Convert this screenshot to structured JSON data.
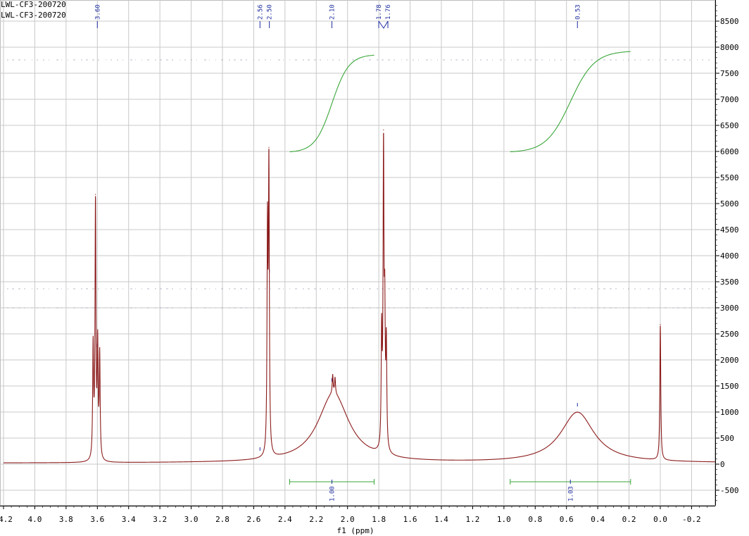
{
  "titles": [
    "LWL-CF3-200720",
    "LWL-CF3-200720"
  ],
  "chart_data": {
    "type": "line",
    "xlabel": "f1 (ppm)",
    "ylabel": "",
    "xlim": [
      4.2,
      -0.35
    ],
    "ylim": [
      -700,
      8850
    ],
    "x_reversed": true,
    "grid": true,
    "x_ticks": [
      4.2,
      4.0,
      3.8,
      3.6,
      3.4,
      3.2,
      3.0,
      2.8,
      2.6,
      2.4,
      2.2,
      2.0,
      1.8,
      1.6,
      1.4,
      1.2,
      1.0,
      0.8,
      0.6,
      0.4,
      0.2,
      0.0,
      -0.2
    ],
    "x_tick_labels": [
      "4.2",
      "4.0",
      "3.8",
      "3.6",
      "3.4",
      "3.2",
      "3.0",
      "2.8",
      "2.6",
      "2.4",
      "2.2",
      "2.0",
      "1.8",
      "1.6",
      "1.4",
      "1.2",
      "1.0",
      "0.8",
      "0.6",
      "0.4",
      "0.2",
      "0.0",
      "-0.2"
    ],
    "y_ticks": [
      -500,
      0,
      500,
      1000,
      1500,
      2000,
      2500,
      3000,
      3500,
      4000,
      4500,
      5000,
      5500,
      6000,
      6500,
      7000,
      7500,
      8000,
      8500
    ],
    "y_tick_labels": [
      "-500",
      "0",
      "500",
      "1000",
      "1500",
      "2000",
      "2500",
      "3000",
      "3500",
      "4000",
      "4500",
      "5000",
      "5500",
      "6000",
      "6500",
      "7000",
      "7500",
      "8000",
      "8500"
    ],
    "peak_labels": [
      {
        "ppm": 3.6,
        "label": "3.60"
      },
      {
        "ppm": 2.56,
        "label": "2.56"
      },
      {
        "ppm": 2.5,
        "label": "2.50"
      },
      {
        "ppm": 2.1,
        "label": "2.10"
      },
      {
        "ppm": 1.78,
        "label": "1.78"
      },
      {
        "ppm": 1.76,
        "label": "1.76"
      },
      {
        "ppm": 0.53,
        "label": "0.53"
      }
    ],
    "integrals": [
      {
        "from": 2.37,
        "to": 1.83,
        "value": "1.00",
        "curve_start": 5980,
        "curve_end": 7860
      },
      {
        "from": 0.96,
        "to": 0.19,
        "value": "1.03",
        "curve_start": 5980,
        "curve_end": 7930
      }
    ],
    "peaks": [
      {
        "shape": "sharp",
        "ppm": 3.627,
        "height": 2130
      },
      {
        "shape": "sharp",
        "ppm": 3.612,
        "height": 4880
      },
      {
        "shape": "sharp",
        "ppm": 3.598,
        "height": 2100
      },
      {
        "shape": "sharp",
        "ppm": 3.585,
        "height": 1970
      },
      {
        "shape": "sharp",
        "ppm": 2.512,
        "height": 4200
      },
      {
        "shape": "sharp",
        "ppm": 2.503,
        "height": 5400
      },
      {
        "shape": "broad",
        "ppm": 2.09,
        "height": 1330,
        "width": 0.12
      },
      {
        "shape": "sharp",
        "ppm": 2.095,
        "height": 350
      },
      {
        "shape": "sharp",
        "ppm": 2.08,
        "height": 300
      },
      {
        "shape": "sharp",
        "ppm": 1.782,
        "height": 2150
      },
      {
        "shape": "sharp",
        "ppm": 1.77,
        "height": 5600
      },
      {
        "shape": "sharp",
        "ppm": 1.762,
        "height": 2350
      },
      {
        "shape": "sharp",
        "ppm": 1.752,
        "height": 1950
      },
      {
        "shape": "broad",
        "ppm": 0.53,
        "height": 970,
        "width": 0.13
      },
      {
        "shape": "sharp",
        "ppm": 0.0,
        "height": 2600
      }
    ],
    "colors": {
      "spectrum": "#8b1a1a",
      "integral": "#3aa63a",
      "label": "#1f2fa0",
      "grid": "#c8c8c8"
    }
  }
}
